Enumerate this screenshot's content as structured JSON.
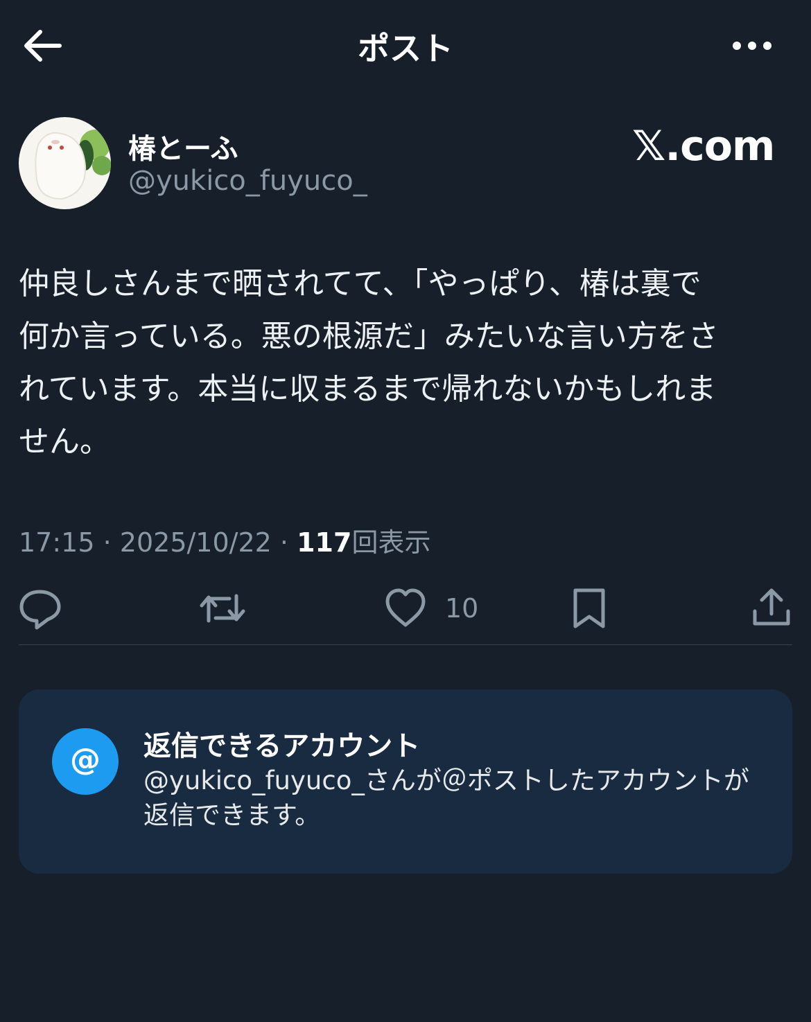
{
  "header": {
    "title": "ポスト",
    "back_icon": "arrow-left-icon",
    "more_icon": "more-horizontal-icon"
  },
  "post": {
    "display_name": "椿とーふ",
    "handle": "@yukico_fuyuco_",
    "watermark": "𝕏.com",
    "text": "仲良しさんまで晒されてて、「やっぱり、椿は裏で\n何か言っている。悪の根源だ」みたいな言い方をさ\nれています。本当に収まるまで帰れないかもしれま\nせん。",
    "time": "17:15",
    "date": "2025/10/22",
    "views_count": "117",
    "views_label": "回表示",
    "separator": "·"
  },
  "actions": {
    "reply_icon": "reply-icon",
    "repost_icon": "repost-icon",
    "like_icon": "heart-icon",
    "like_count": "10",
    "bookmark_icon": "bookmark-icon",
    "share_icon": "share-icon"
  },
  "reply_notice": {
    "icon_text": "@",
    "title": "返信できるアカウント",
    "description": "@yukico_fuyuco_さんが＠ポストしたアカウントが返信できます。"
  },
  "colors": {
    "background": "#17202a",
    "card": "#182b40",
    "accent": "#1d9bf0",
    "muted": "#8b98a5"
  }
}
